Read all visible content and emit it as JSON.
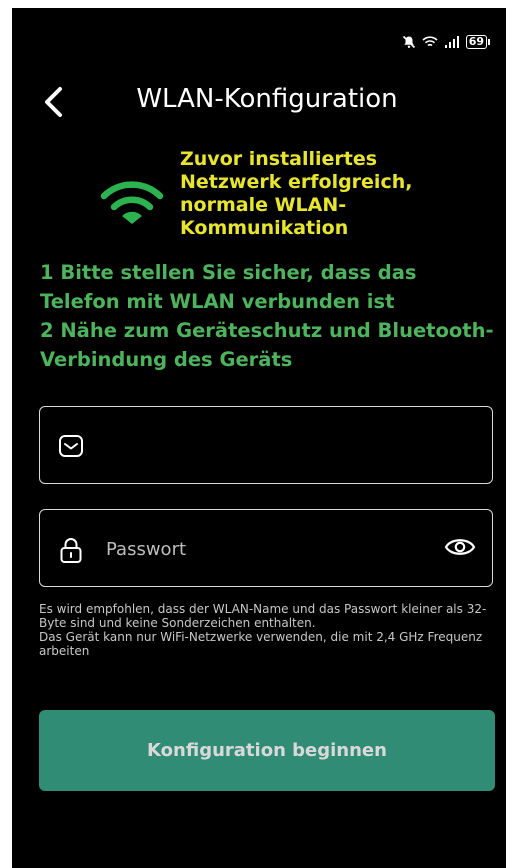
{
  "status_bar": {
    "battery": "69"
  },
  "header": {
    "title": "WLAN-Konfiguration"
  },
  "success_message": "Zuvor installiertes Netzwerk erfolgreich, normale WLAN-Kommunikation",
  "instructions": {
    "line1": "1 Bitte stellen Sie sicher, dass das Telefon mit WLAN verbunden ist",
    "line2": "2 Nähe zum Geräteschutz und Bluetooth-Verbindung des Geräts"
  },
  "form": {
    "ssid_value": "",
    "password_placeholder": "Passwort"
  },
  "hint": {
    "line1": "Es wird empfohlen, dass der WLAN-Name und das Passwort kleiner als 32-Byte sind und keine Sonderzeichen enthalten.",
    "line2": "Das Gerät kann nur WiFi-Netzwerke verwenden, die mit 2,4 GHz Frequenz arbeiten"
  },
  "button": {
    "label": "Konfiguration beginnen"
  },
  "colors": {
    "accent": "#3aa58a",
    "success_text": "#e8e52f",
    "instruction_text": "#4db35d",
    "background": "#000000"
  }
}
